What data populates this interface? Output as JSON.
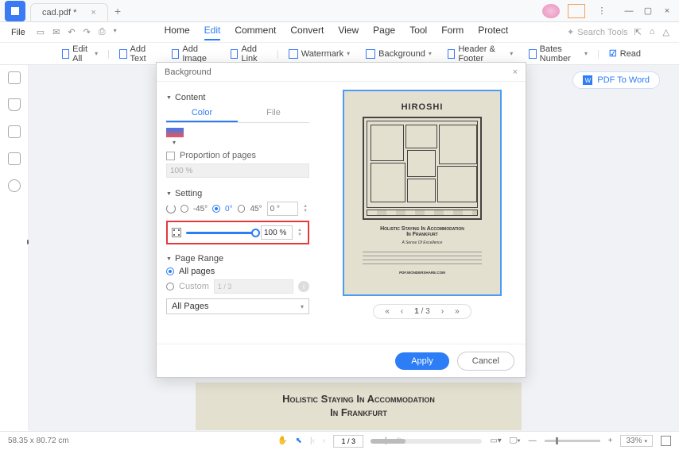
{
  "app": {
    "tab_filename": "cad.pdf *"
  },
  "file_menu": "File",
  "menu": {
    "home": "Home",
    "edit": "Edit",
    "comment": "Comment",
    "convert": "Convert",
    "view": "View",
    "page": "Page",
    "tool": "Tool",
    "form": "Form",
    "protect": "Protect"
  },
  "search_placeholder": "Search Tools",
  "ribbon": {
    "edit_all": "Edit All",
    "add_text": "Add Text",
    "add_image": "Add Image",
    "add_link": "Add Link",
    "watermark": "Watermark",
    "background": "Background",
    "header_footer": "Header & Footer",
    "bates": "Bates Number",
    "read": "Read"
  },
  "pdf_to_word": "PDF To Word",
  "dialog": {
    "title": "Background",
    "sections": {
      "content": "Content",
      "setting": "Setting",
      "page_range": "Page Range"
    },
    "tabs": {
      "color": "Color",
      "file": "File"
    },
    "proportion_label": "Proportion of pages",
    "proportion_value": "100  %",
    "angles": {
      "m45": "-45°",
      "z": "0°",
      "p45": "45°",
      "custom": "0 °"
    },
    "zoom_value": "100  %",
    "all_pages": "All pages",
    "custom": "Custom",
    "custom_placeholder": "1 / 3",
    "select": "All Pages",
    "preview_pager": {
      "current": "1",
      "total": "/ 3"
    },
    "apply": "Apply",
    "cancel": "Cancel"
  },
  "preview_doc": {
    "title": "HIROSHI",
    "subtitle1": "Holistic Staying In Accommodation",
    "subtitle2": "In Frankfurt",
    "watermark": "PDF.WONDERSHARE.COM"
  },
  "doc_bottom": {
    "line1": "Holistic Staying In Accommodation",
    "line2": "In Frankfurt"
  },
  "status": {
    "dims": "58.35 x 80.72 cm",
    "page": "1 / 3",
    "zoom": "33%"
  }
}
